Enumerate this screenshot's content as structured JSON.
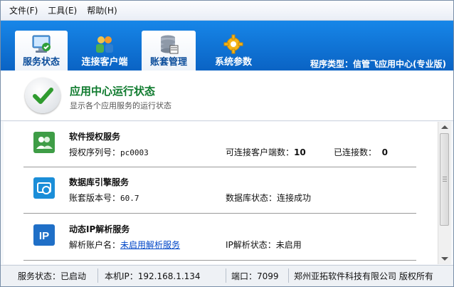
{
  "menu": {
    "file": "文件(F)",
    "tools": "工具(E)",
    "help": "帮助(H)"
  },
  "tabs": [
    {
      "label": "服务状态"
    },
    {
      "label": "连接客户端"
    },
    {
      "label": "账套管理"
    },
    {
      "label": "系统参数"
    }
  ],
  "program_type": "程序类型：信管飞应用中心(专业版)",
  "header": {
    "title": "应用中心运行状态",
    "subtitle": "显示各个应用服务的运行状态"
  },
  "services": [
    {
      "title": "软件授权服务",
      "f1_label": "授权序列号：",
      "f1_value": "pc0003",
      "f2_label": "可连接客户端数：",
      "f2_value": "10",
      "f3_label": "已连接数：",
      "f3_value": "0"
    },
    {
      "title": "数据库引擎服务",
      "f1_label": "账套版本号：",
      "f1_value": "60.7",
      "f2_label": "数据库状态：",
      "f2_value": "连接成功"
    },
    {
      "title": "动态IP解析服务",
      "f1_label": "解析账户名：",
      "f1_value": "未启用解析服务",
      "f2_label": "IP解析状态：",
      "f2_value": "未启用"
    }
  ],
  "ip_icon_text": "IP",
  "status": {
    "service": "服务状态：已启动",
    "ip": "本机IP：192.168.1.134",
    "port": "端口：7099",
    "company": "郑州亚拓软件科技有限公司 版权所有"
  },
  "colors": {
    "toolbar_blue": "#0a63c4",
    "header_green": "#0e7a2d",
    "link_blue": "#0046c7"
  }
}
